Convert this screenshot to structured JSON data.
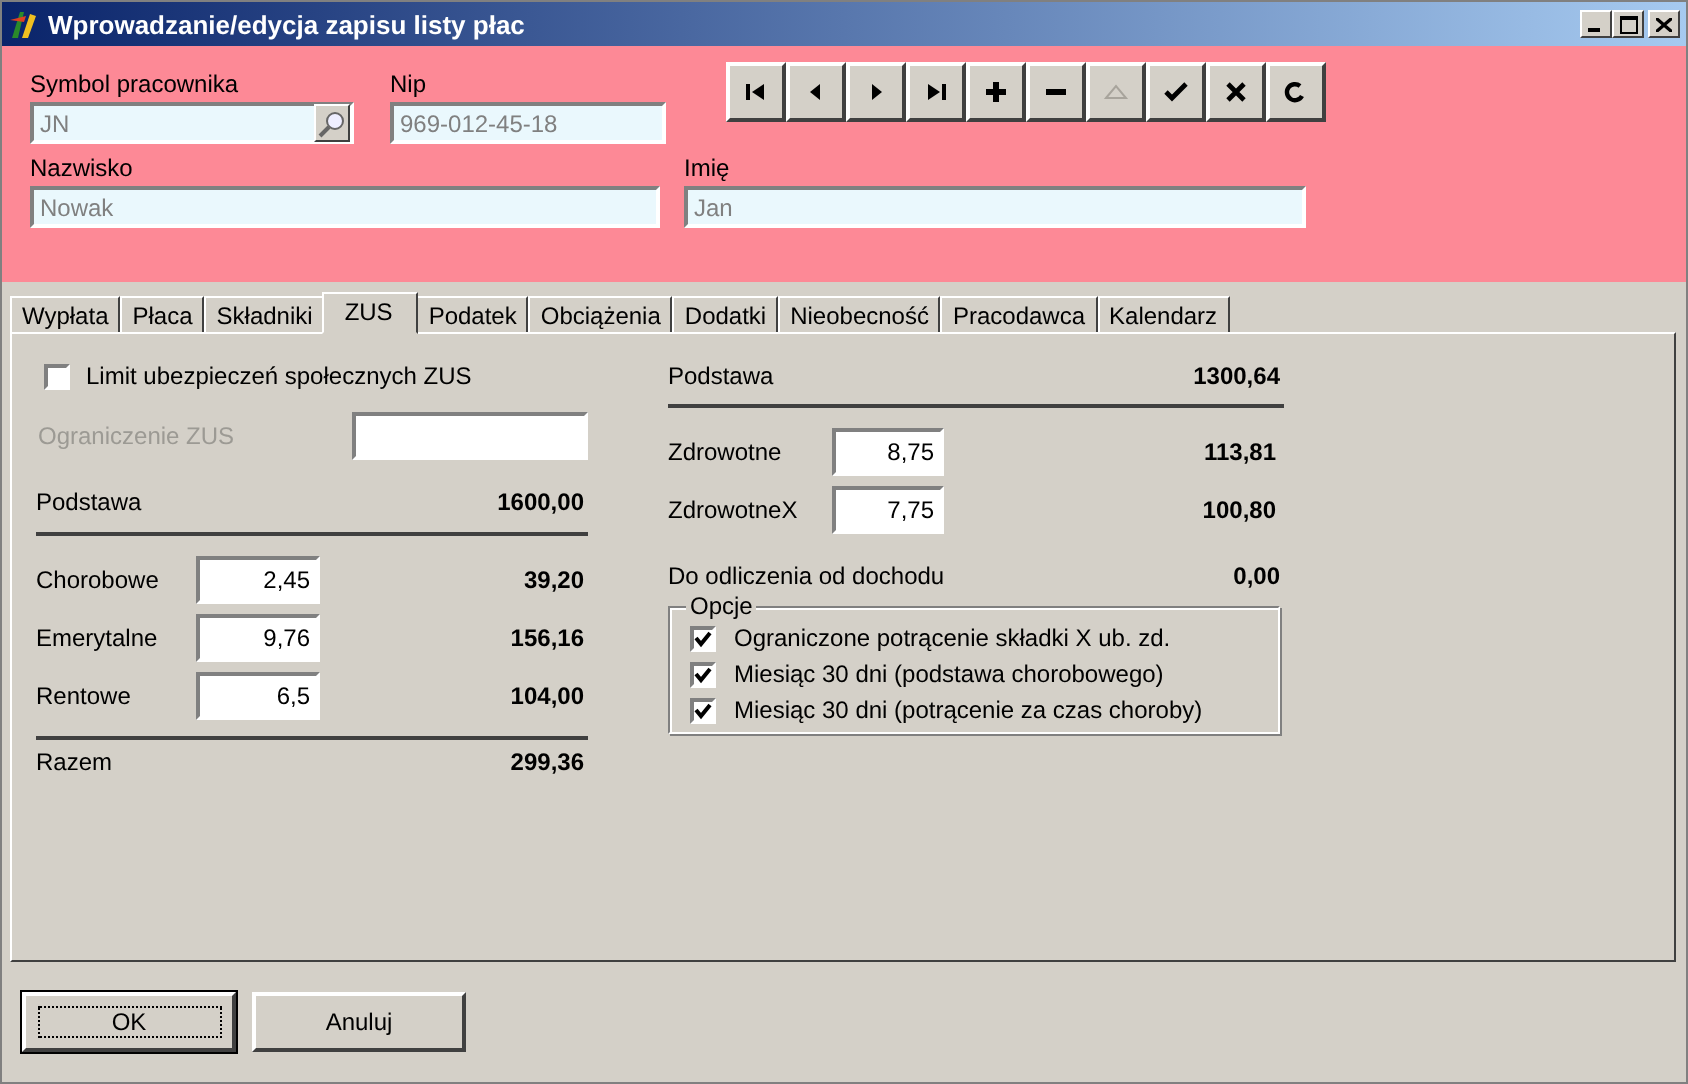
{
  "window": {
    "title": "Wprowadzanie/edycja zapisu listy płac"
  },
  "employee": {
    "symbol": {
      "label": "Symbol pracownika",
      "value": "JN"
    },
    "nip": {
      "label": "Nip",
      "value": "969-012-45-18"
    },
    "surname": {
      "label": "Nazwisko",
      "value": "Nowak"
    },
    "first_name": {
      "label": "Imię",
      "value": "Jan"
    }
  },
  "navigator": [
    {
      "kind": "first",
      "disabled": false
    },
    {
      "kind": "prev",
      "disabled": false
    },
    {
      "kind": "next",
      "disabled": false
    },
    {
      "kind": "last",
      "disabled": false
    },
    {
      "kind": "add",
      "disabled": false
    },
    {
      "kind": "delete",
      "disabled": false
    },
    {
      "kind": "edit",
      "disabled": true
    },
    {
      "kind": "post",
      "disabled": false
    },
    {
      "kind": "cancel",
      "disabled": false
    },
    {
      "kind": "refresh",
      "disabled": false
    }
  ],
  "tabs": [
    {
      "label": "Wypłata",
      "selected": false
    },
    {
      "label": "Płaca",
      "selected": false
    },
    {
      "label": "Składniki",
      "selected": false
    },
    {
      "label": "ZUS",
      "selected": true
    },
    {
      "label": "Podatek",
      "selected": false
    },
    {
      "label": "Obciążenia",
      "selected": false
    },
    {
      "label": "Dodatki",
      "selected": false
    },
    {
      "label": "Nieobecność",
      "selected": false
    },
    {
      "label": "Pracodawca",
      "selected": false
    },
    {
      "label": "Kalendarz",
      "selected": false
    }
  ],
  "zus": {
    "limit": {
      "label": "Limit ubezpieczeń społecznych ZUS",
      "checked": false
    },
    "limit_field": {
      "label": "Ograniczenie ZUS",
      "disabled": true
    },
    "base": {
      "label": "Podstawa",
      "amount": "1600,00"
    },
    "contributions": [
      {
        "label": "Chorobowe",
        "rate": "2,45",
        "amount": "39,20"
      },
      {
        "label": "Emerytalne",
        "rate": "9,76",
        "amount": "156,16"
      },
      {
        "label": "Rentowe",
        "rate": "6,5",
        "amount": "104,00"
      }
    ],
    "total": {
      "label": "Razem",
      "amount": "299,36"
    }
  },
  "health": {
    "base": {
      "label": "Podstawa",
      "amount": "1300,64"
    },
    "contributions": [
      {
        "label": "Zdrowotne",
        "rate": "8,75",
        "amount": "113,81"
      },
      {
        "label": "ZdrowotneX",
        "rate": "7,75",
        "amount": "100,80"
      }
    ],
    "deduction": {
      "label": "Do odliczenia od dochodu",
      "amount": "0,00"
    },
    "options": {
      "title": "Opcje",
      "items": [
        {
          "label": "Ograniczone potrącenie składki X ub. zd.",
          "checked": true
        },
        {
          "label": "Miesiąc 30 dni (podstawa chorobowego)",
          "checked": true
        },
        {
          "label": "Miesiąc 30 dni (potrącenie za czas choroby)",
          "checked": true
        }
      ]
    }
  },
  "buttons": [
    {
      "label": "OK",
      "default": true
    },
    {
      "label": "Anuluj",
      "default": false
    }
  ]
}
